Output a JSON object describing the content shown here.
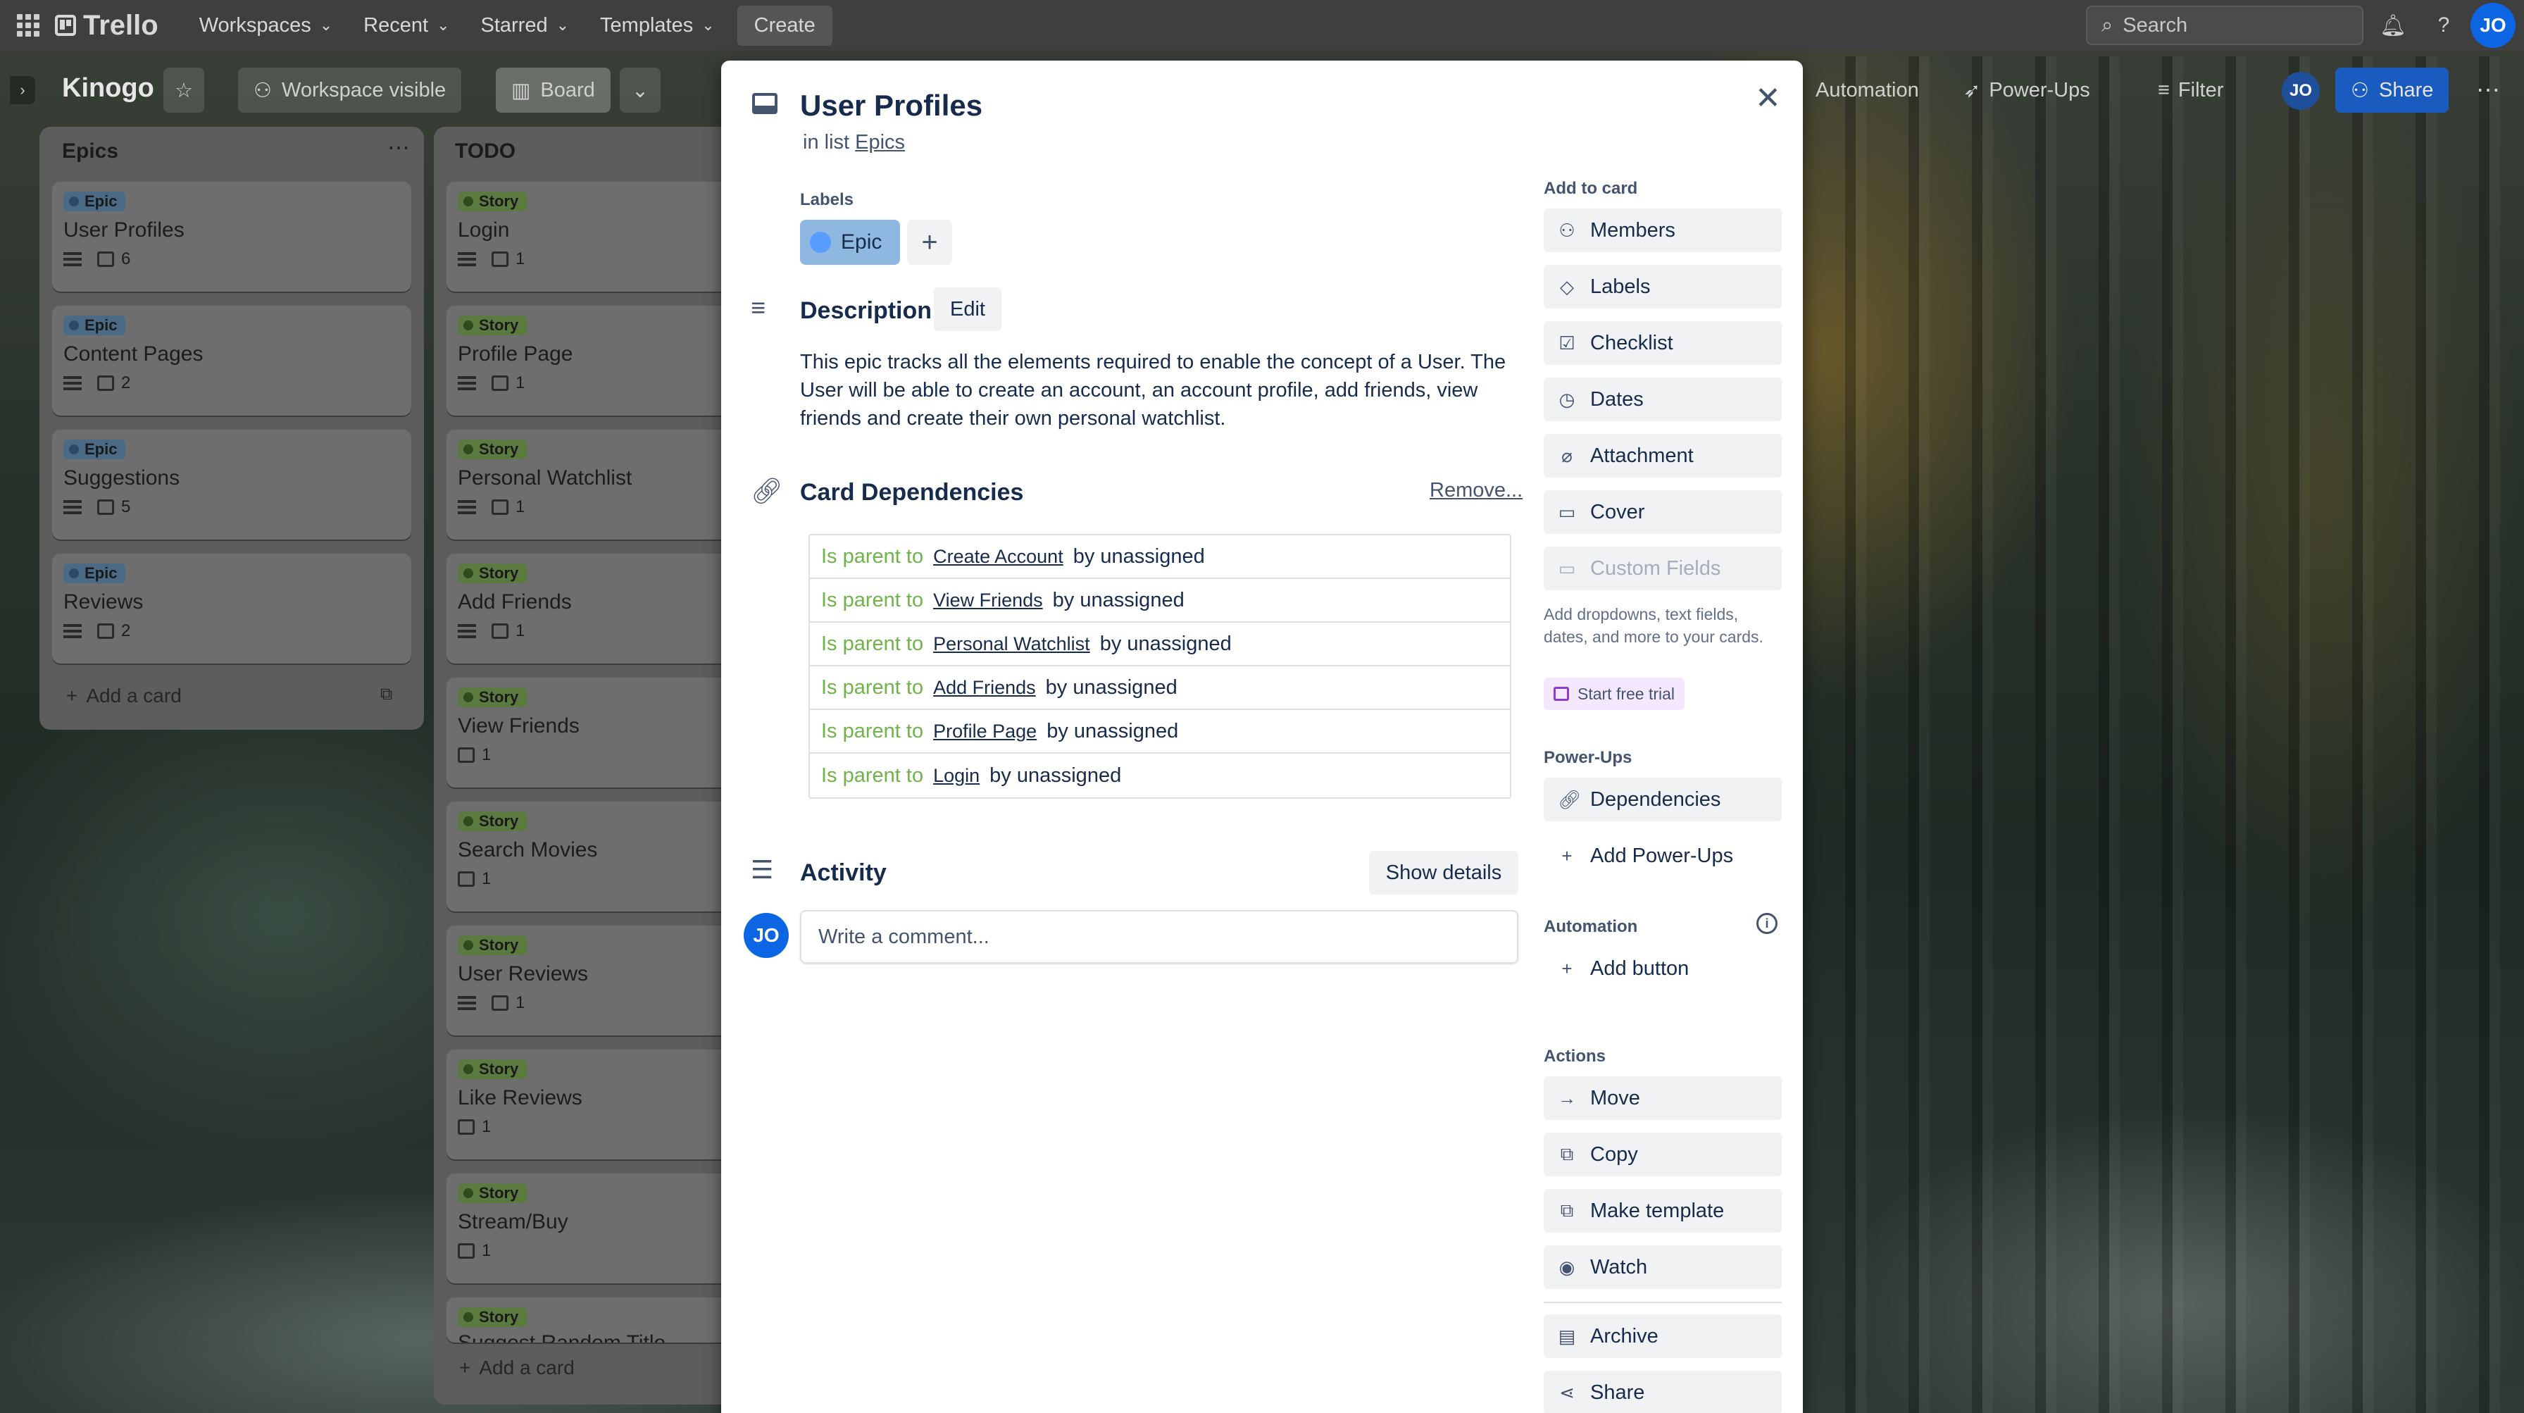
{
  "topbar": {
    "logo": "Trello",
    "nav": [
      "Workspaces",
      "Recent",
      "Starred",
      "Templates"
    ],
    "create": "Create",
    "search_placeholder": "Search",
    "avatar": "JO"
  },
  "board": {
    "title": "Kinogo",
    "visibility": "Workspace visible",
    "view": "Board",
    "automation": "Automation",
    "powerups": "Power-Ups",
    "filter": "Filter",
    "share": "Share",
    "avatar": "JO"
  },
  "lists": {
    "epics": {
      "title": "Epics",
      "cards": [
        {
          "label": "Epic",
          "title": "User Profiles",
          "count": "6"
        },
        {
          "label": "Epic",
          "title": "Content Pages",
          "count": "2"
        },
        {
          "label": "Epic",
          "title": "Suggestions",
          "count": "5"
        },
        {
          "label": "Epic",
          "title": "Reviews",
          "count": "2"
        }
      ],
      "add_card": "Add a card"
    },
    "todo": {
      "title": "TODO",
      "cards": [
        {
          "label": "Story",
          "title": "Login",
          "count": "1"
        },
        {
          "label": "Story",
          "title": "Profile Page",
          "count": "1"
        },
        {
          "label": "Story",
          "title": "Personal Watchlist",
          "count": "1"
        },
        {
          "label": "Story",
          "title": "Add Friends",
          "count": "1"
        },
        {
          "label": "Story",
          "title": "View Friends",
          "count": "1"
        },
        {
          "label": "Story",
          "title": "Search Movies",
          "count": "1"
        },
        {
          "label": "Story",
          "title": "User Reviews",
          "count": "1"
        },
        {
          "label": "Story",
          "title": "Like Reviews",
          "count": "1"
        },
        {
          "label": "Story",
          "title": "Stream/Buy",
          "count": "1"
        },
        {
          "label": "Story",
          "title": "Suggest Random Title",
          "count": ""
        }
      ],
      "add_card": "Add a card"
    }
  },
  "modal": {
    "title": "User Profiles",
    "in_list_prefix": "in list",
    "in_list": "Epics",
    "labels_heading": "Labels",
    "label_chip": "Epic",
    "description_heading": "Description",
    "edit": "Edit",
    "description": "This epic tracks all the elements required to enable the concept of a User. The User will be able to create an account, an account profile, add friends, view friends and create their own personal watchlist.",
    "deps_heading": "Card Dependencies",
    "remove": "Remove...",
    "dependencies": [
      {
        "rel": "Is parent to",
        "card": "Create Account",
        "by": "by unassigned"
      },
      {
        "rel": "Is parent to",
        "card": "View Friends",
        "by": "by unassigned"
      },
      {
        "rel": "Is parent to",
        "card": "Personal Watchlist",
        "by": "by unassigned"
      },
      {
        "rel": "Is parent to",
        "card": "Add Friends",
        "by": "by unassigned"
      },
      {
        "rel": "Is parent to",
        "card": "Profile Page",
        "by": "by unassigned"
      },
      {
        "rel": "Is parent to",
        "card": "Login",
        "by": "by unassigned"
      }
    ],
    "activity_heading": "Activity",
    "show_details": "Show details",
    "comment_placeholder": "Write a comment...",
    "avatar": "JO"
  },
  "sidebar": {
    "add_to_card": "Add to card",
    "members": "Members",
    "labels": "Labels",
    "checklist": "Checklist",
    "dates": "Dates",
    "attachment": "Attachment",
    "cover": "Cover",
    "custom_fields": "Custom Fields",
    "custom_fields_note": "Add dropdowns, text fields, dates, and more to your cards.",
    "start_trial": "Start free trial",
    "powerups_heading": "Power-Ups",
    "dependencies": "Dependencies",
    "add_powerups": "Add Power-Ups",
    "automation_heading": "Automation",
    "add_button": "Add button",
    "actions_heading": "Actions",
    "move": "Move",
    "copy": "Copy",
    "make_template": "Make template",
    "watch": "Watch",
    "archive": "Archive",
    "share": "Share"
  },
  "colors": {
    "accent": "#0c66e4",
    "dep_relation": "#6fb34a",
    "epic_chip": "#8fb8e0"
  }
}
